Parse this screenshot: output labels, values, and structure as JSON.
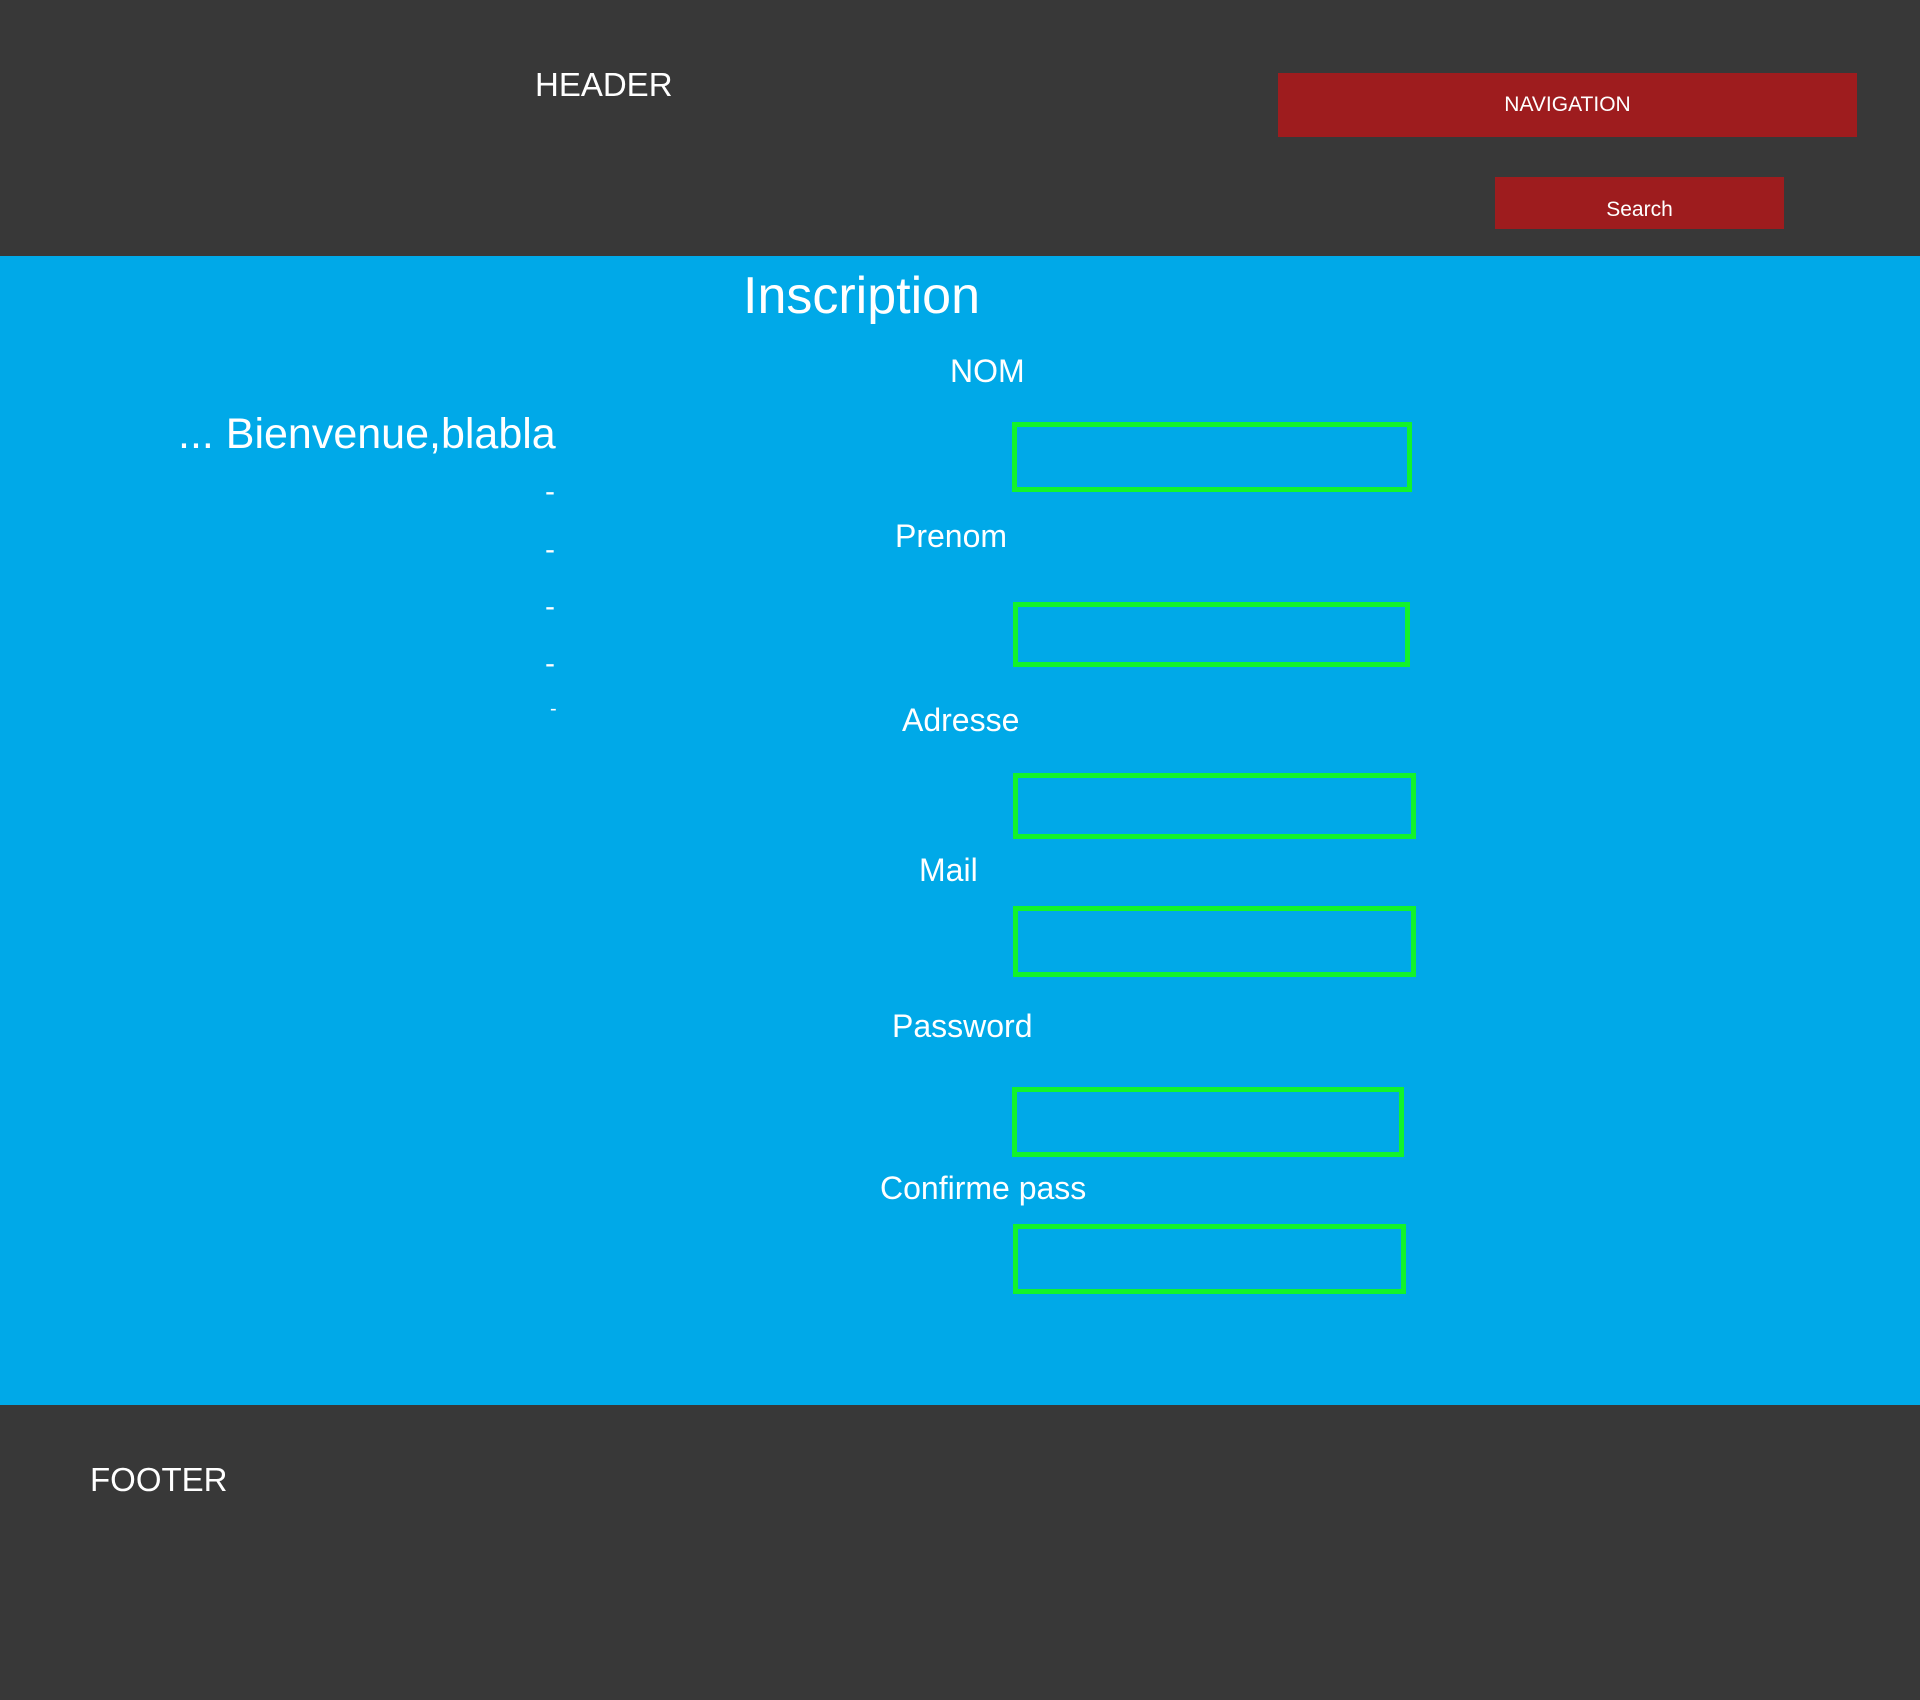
{
  "header": {
    "title": "HEADER",
    "navigation_label": "NAVIGATION",
    "search_label": "Search"
  },
  "main": {
    "title": "Inscription",
    "welcome_text": "... Bienvenue,blabla",
    "bullets": [
      "-",
      "-",
      "-",
      "-",
      "-"
    ],
    "form": {
      "nom_label": "NOM",
      "nom_value": "",
      "prenom_label": "Prenom",
      "prenom_value": "",
      "adresse_label": "Adresse",
      "adresse_value": "",
      "mail_label": "Mail",
      "mail_value": "",
      "password_label": "Password",
      "password_value": "",
      "confirm_label": "Confirme pass",
      "confirm_value": ""
    }
  },
  "footer": {
    "title": "FOOTER"
  },
  "colors": {
    "header_bg": "#383838",
    "main_bg": "#00a9e8",
    "footer_bg": "#383838",
    "button_bg": "#9e1c1e",
    "input_border": "#12f42a",
    "text": "#ffffff"
  }
}
